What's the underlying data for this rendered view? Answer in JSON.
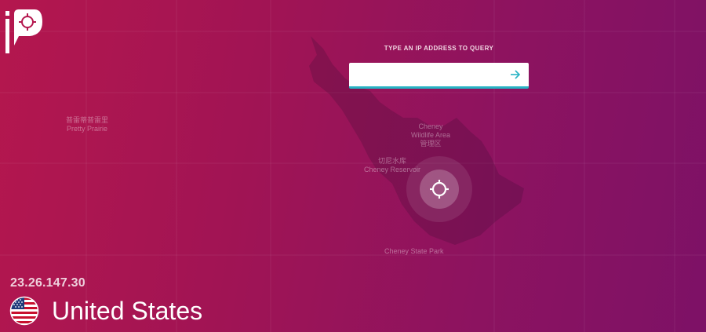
{
  "app": {
    "logo_icon": "ip-locate-logo-icon"
  },
  "query": {
    "label": "TYPE AN IP ADDRESS TO QUERY",
    "value": "",
    "placeholder": "",
    "submit_icon": "arrow-right-icon",
    "accent_color": "#27b3c4"
  },
  "map": {
    "places": [
      {
        "primary": "普雷蒂普雷里",
        "secondary": "Pretty Prairie"
      },
      {
        "primary": "Cheney",
        "secondary": "Wildlife Area",
        "tertiary": "管理区"
      },
      {
        "primary": "切尼水库",
        "secondary": "Cheney Reservoir"
      },
      {
        "primary": "Cheney State Park"
      }
    ],
    "locate_icon": "crosshair-icon"
  },
  "result": {
    "ip": "23.26.147.30",
    "country": "United States",
    "flag_icon": "us-flag-icon"
  },
  "colors": {
    "background_start": "#b4174e",
    "background_end": "#7d1166"
  }
}
